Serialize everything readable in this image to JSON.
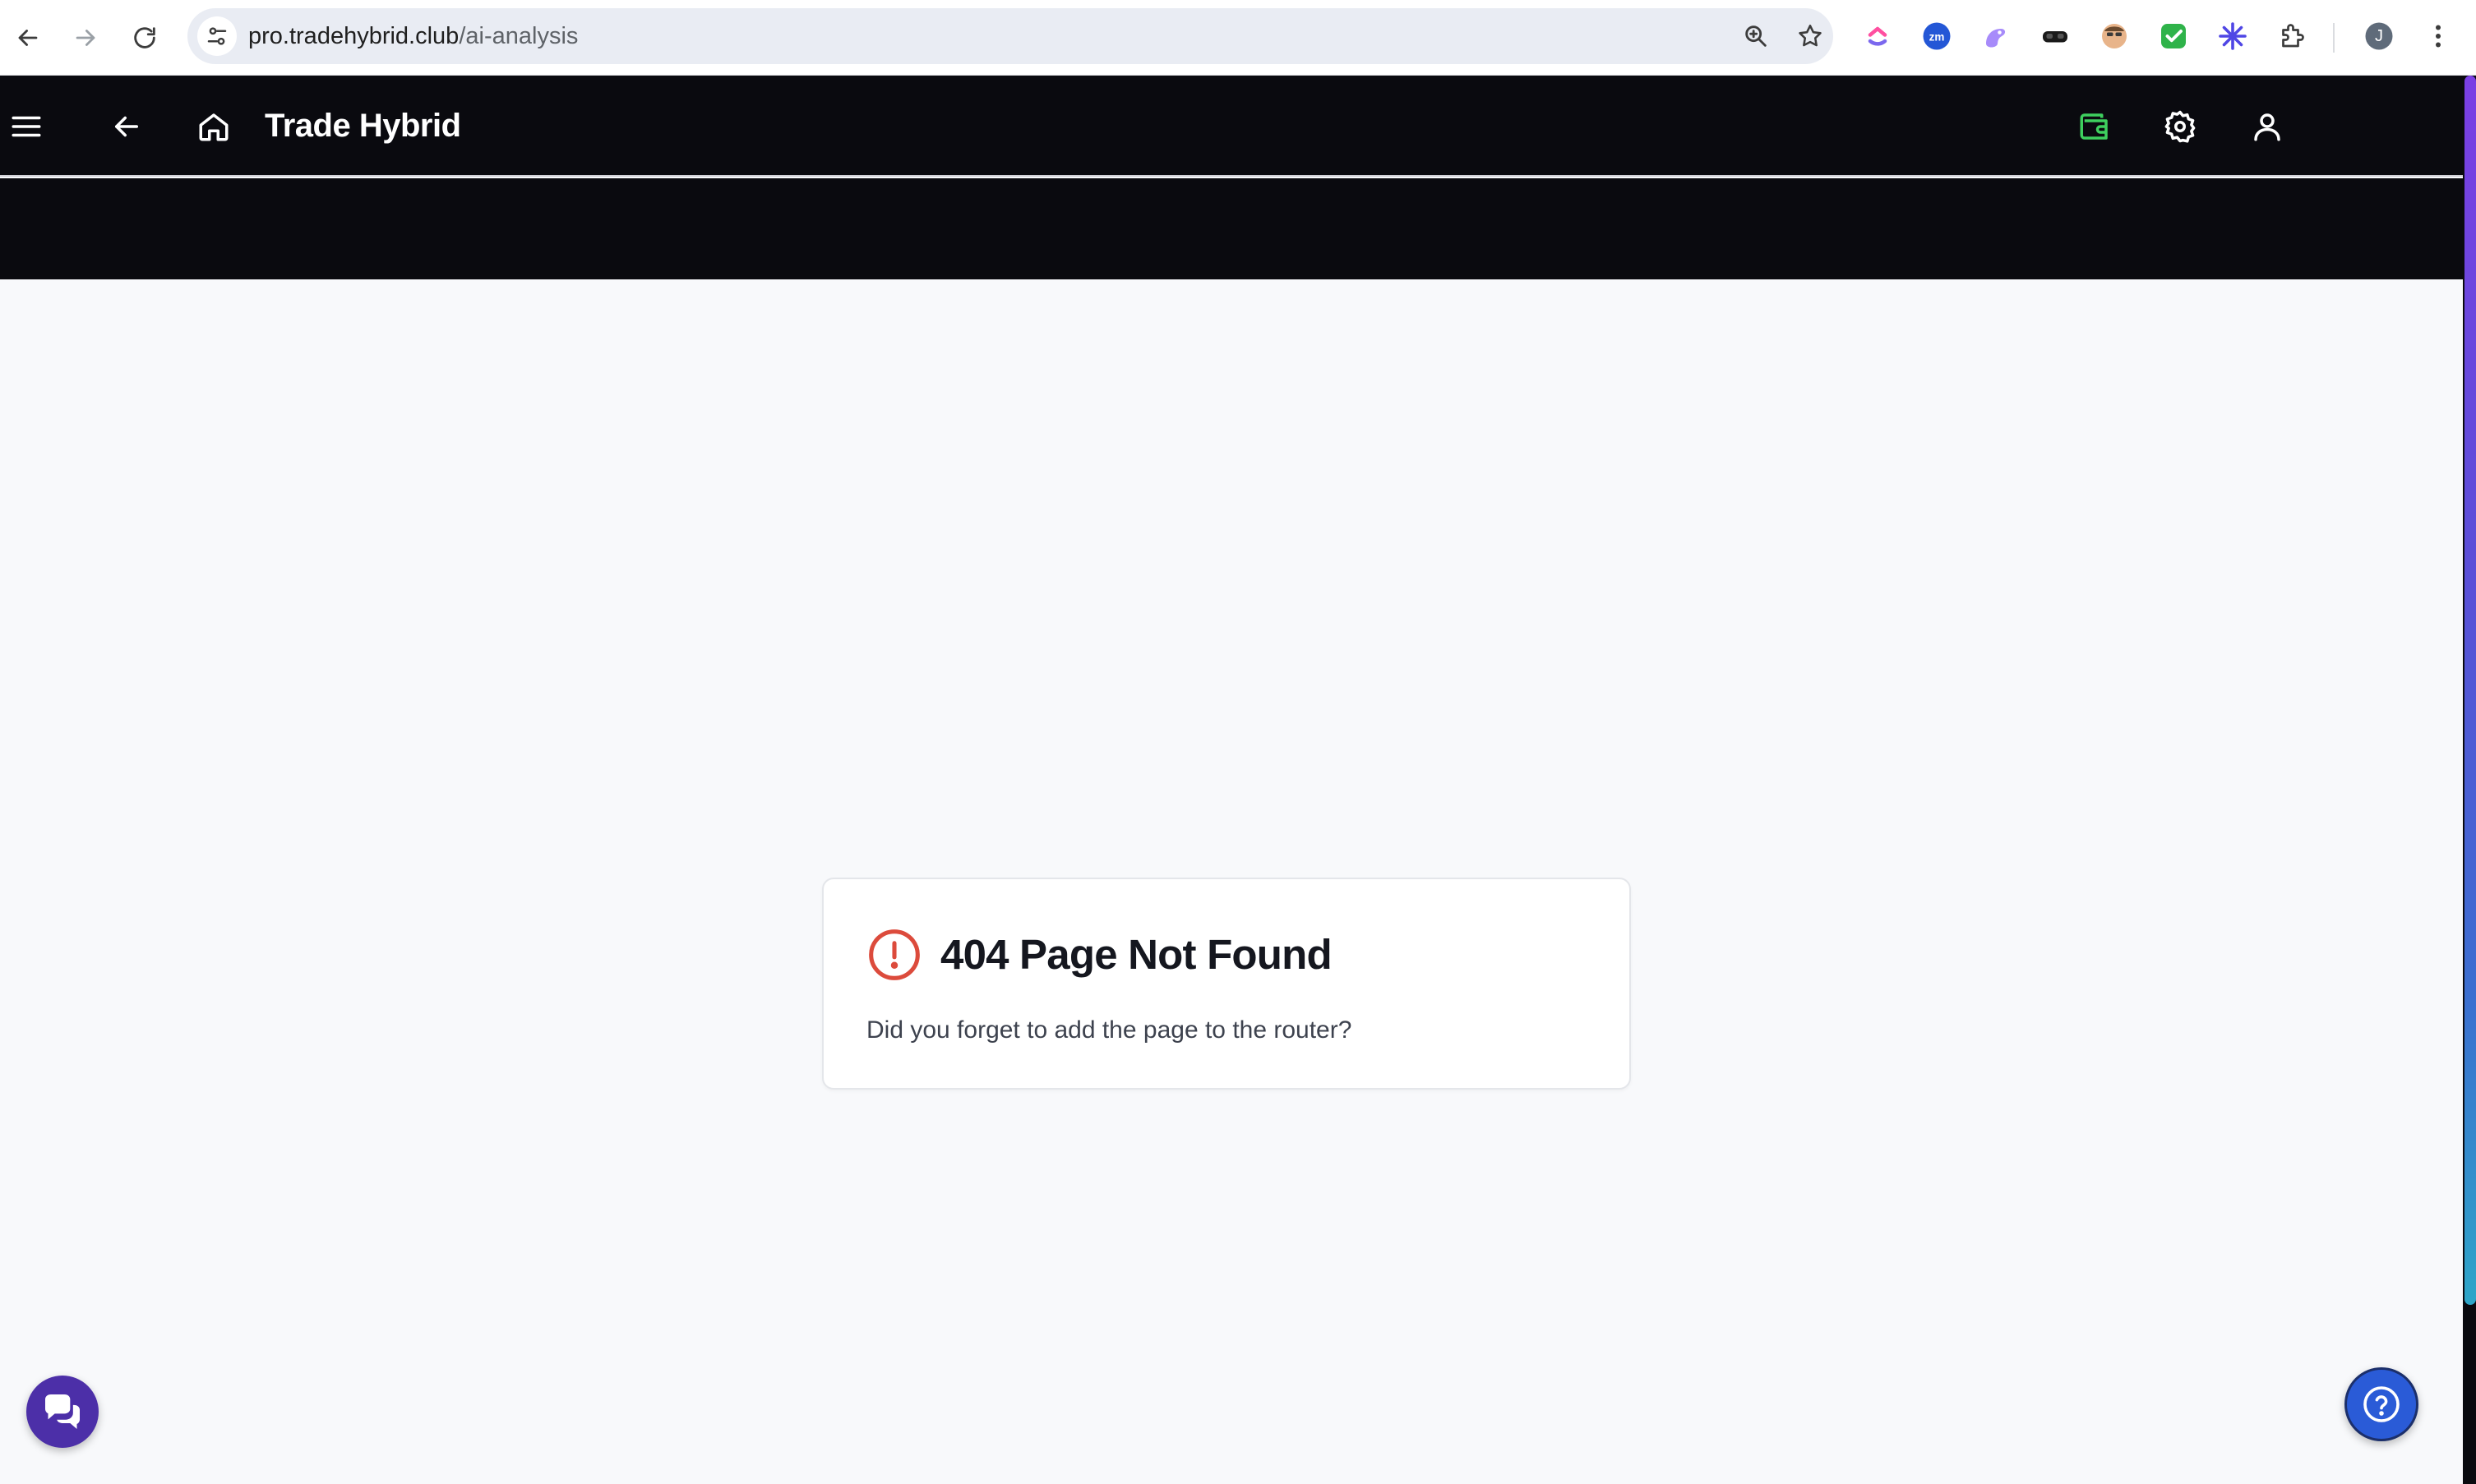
{
  "browser": {
    "url_host": "pro.tradehybrid.club",
    "url_path": "/ai-analysis",
    "profile_initial": "J",
    "extensions": [
      "clickup-icon",
      "zoom-icon",
      "ai-assistant-icon",
      "vr-headset-icon",
      "avatar-extension-icon",
      "checkmark-extension-icon",
      "sparkle-extension-icon",
      "puzzle-icon"
    ]
  },
  "header": {
    "title": "Trade Hybrid",
    "wallet_color": "#3ecf5e"
  },
  "error_card": {
    "title": "404 Page Not Found",
    "message": "Did you forget to add the page to the router?",
    "icon_color": "#dc4b3c"
  },
  "colors": {
    "header_bg": "#0a0a0f",
    "page_bg": "#f8f9fb",
    "chat_fab": "#4c2fa8",
    "help_fab": "#2a5bd7"
  }
}
